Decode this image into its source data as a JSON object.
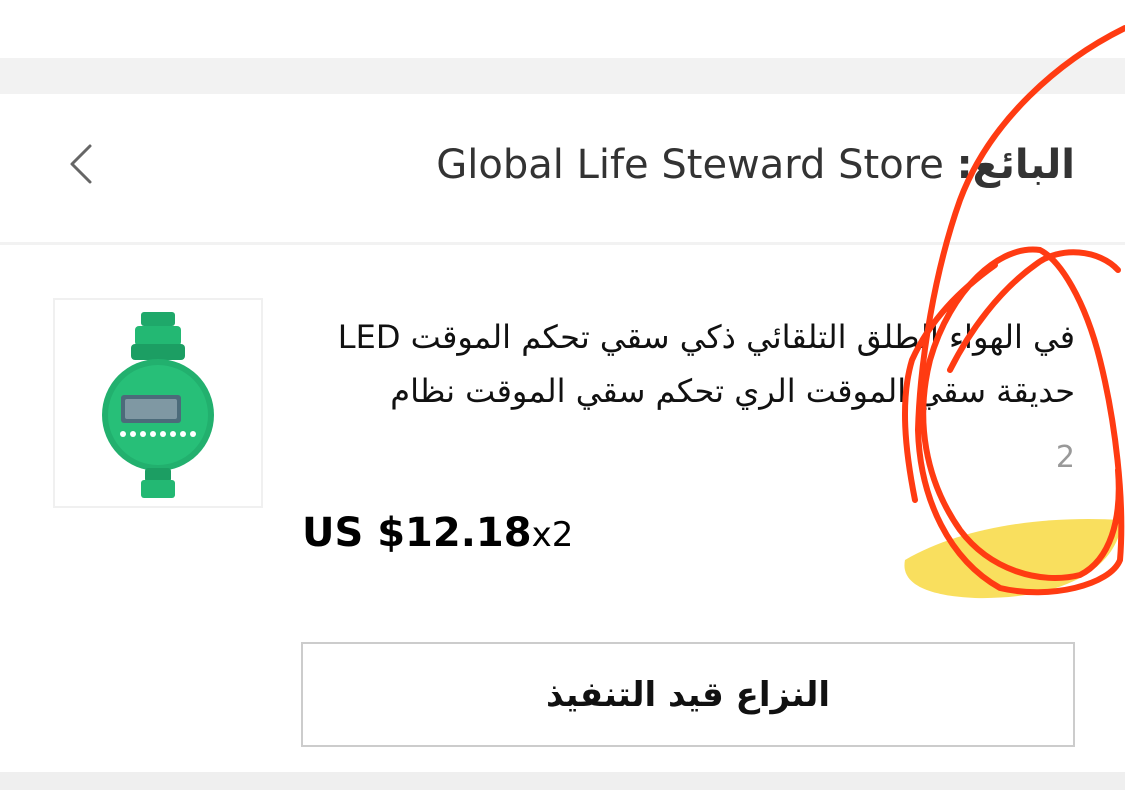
{
  "header": {
    "seller_label": "البائع:",
    "store_name": "Global Life Steward Store"
  },
  "product": {
    "title": "في الهواء الطلق التلقائي ذكي سقي تحكم الموقت LED حديقة سقي الموقت الري تحكم سقي الموقت نظام",
    "quantity_label": "2",
    "price": "US $12.18",
    "multiplier": "x2",
    "image_icon": "water-timer-product-icon"
  },
  "actions": {
    "dispute_label": "النزاع قيد التنفيذ"
  },
  "icons": {
    "back": "chevron-left-icon"
  },
  "colors": {
    "annotation_red": "#ff3b12",
    "annotation_yellow": "#f7d21a",
    "product_green": "#1fa86a"
  }
}
